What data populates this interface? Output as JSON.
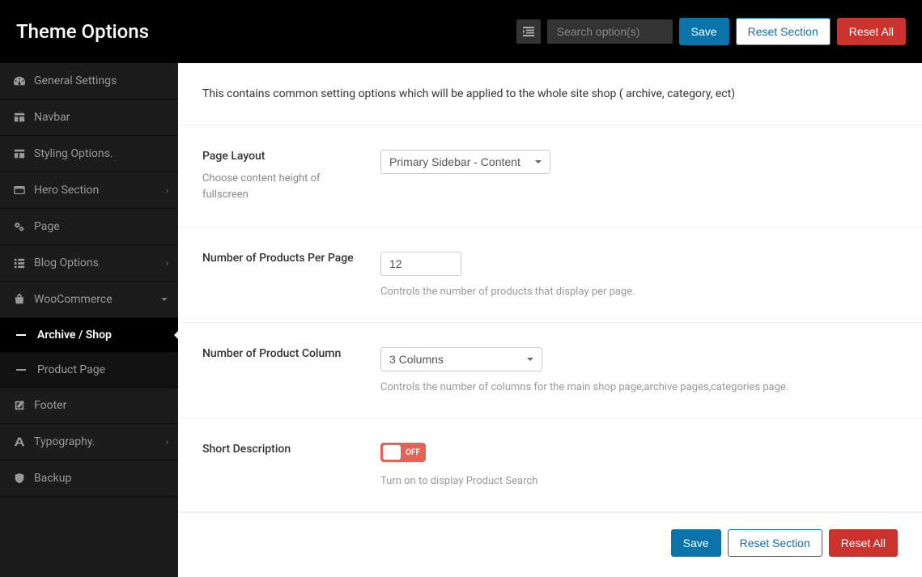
{
  "header": {
    "title": "Theme Options",
    "search_placeholder": "Search option(s)",
    "save": "Save",
    "reset_section": "Reset Section",
    "reset_all": "Reset All"
  },
  "sidebar": {
    "items": [
      {
        "label": "General Settings",
        "icon": "dashboard"
      },
      {
        "label": "Navbar",
        "icon": "layout"
      },
      {
        "label": "Styling Options.",
        "icon": "layout"
      },
      {
        "label": "Hero Section",
        "icon": "panel",
        "chevron": true
      },
      {
        "label": "Page",
        "icon": "gears"
      },
      {
        "label": "Blog Options",
        "icon": "list",
        "chevron": true
      },
      {
        "label": "WooCommerce",
        "icon": "bag",
        "chevron": "down"
      },
      {
        "label": "Footer",
        "icon": "edit"
      },
      {
        "label": "Typography.",
        "icon": "font",
        "chevron": true
      },
      {
        "label": "Backup",
        "icon": "shield"
      }
    ],
    "sub": [
      {
        "label": "Archive / Shop",
        "active": true
      },
      {
        "label": "Product Page"
      }
    ]
  },
  "intro": "This contains common setting options which will be applied to the whole site shop ( archive, category, ect)",
  "settings": {
    "page_layout": {
      "label": "Page Layout",
      "desc": "Choose content height of fullscreen",
      "value": "Primary Sidebar - Content"
    },
    "products_per_page": {
      "label": "Number of Products Per Page",
      "value": "12",
      "help": "Controls the number of products that display per page."
    },
    "product_column": {
      "label": "Number of Product Column",
      "value": "3 Columns",
      "help": "Controls the number of columns for the main shop page,archive pages,categories page."
    },
    "short_desc": {
      "label": "Short Description",
      "state": "OFF",
      "help": "Turn on to display Product Search"
    }
  },
  "footer": {
    "save": "Save",
    "reset_section": "Reset Section",
    "reset_all": "Reset All"
  }
}
